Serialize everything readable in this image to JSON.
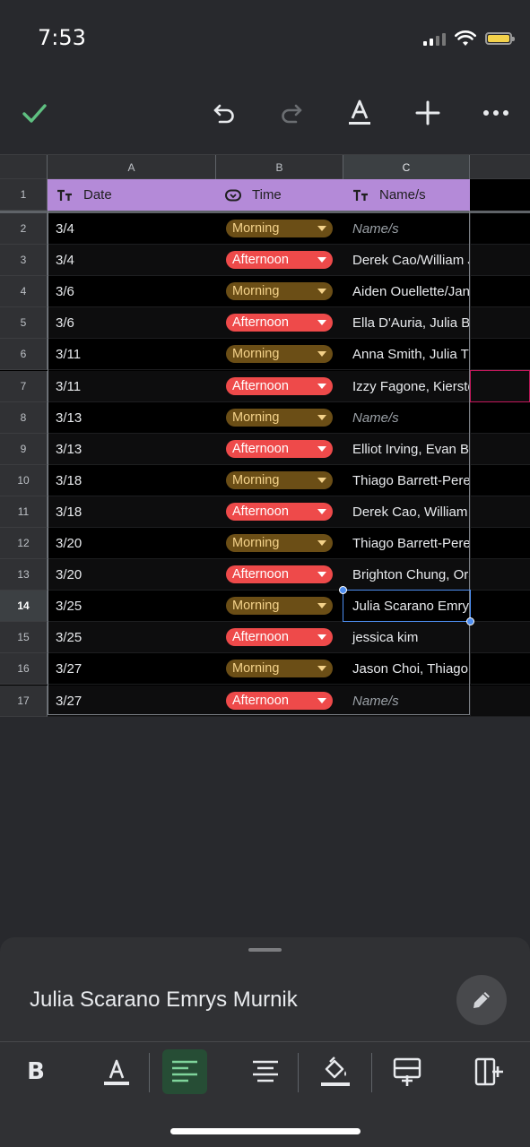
{
  "status_bar": {
    "time": "7:53"
  },
  "toolbar": {
    "done_icon": "check-icon",
    "undo_icon": "undo-icon",
    "redo_icon": "redo-icon",
    "text_format_icon": "text-color-icon",
    "insert_icon": "plus-icon",
    "more_icon": "more-horizontal-icon"
  },
  "columns": [
    "A",
    "B",
    "C"
  ],
  "header": {
    "row_number": "1",
    "date": "Date",
    "time": "Time",
    "names": "Name/s"
  },
  "rows": [
    {
      "num": "2",
      "date": "3/4",
      "time": "Morning",
      "name": "Name/s",
      "placeholder": true
    },
    {
      "num": "3",
      "date": "3/4",
      "time": "Afternoon",
      "name": "Derek Cao/William J",
      "placeholder": false
    },
    {
      "num": "4",
      "date": "3/6",
      "time": "Morning",
      "name": "Aiden Ouellette/Jan",
      "placeholder": false
    },
    {
      "num": "5",
      "date": "3/6",
      "time": "Afternoon",
      "name": "Ella D'Auria, Julia Bu",
      "placeholder": false
    },
    {
      "num": "6",
      "date": "3/11",
      "time": "Morning",
      "name": "Anna Smith, Julia Tu",
      "placeholder": false
    },
    {
      "num": "7",
      "date": "3/11",
      "time": "Afternoon",
      "name": "Izzy Fagone, Kierste",
      "placeholder": false
    },
    {
      "num": "8",
      "date": "3/13",
      "time": "Morning",
      "name": "Name/s",
      "placeholder": true
    },
    {
      "num": "9",
      "date": "3/13",
      "time": "Afternoon",
      "name": "Elliot Irving, Evan Ba",
      "placeholder": false
    },
    {
      "num": "10",
      "date": "3/18",
      "time": "Morning",
      "name": "Thiago Barrett-Pere",
      "placeholder": false
    },
    {
      "num": "11",
      "date": "3/18",
      "time": "Afternoon",
      "name": "Derek Cao, William J",
      "placeholder": false
    },
    {
      "num": "12",
      "date": "3/20",
      "time": "Morning",
      "name": "Thiago Barrett-Pere",
      "placeholder": false
    },
    {
      "num": "13",
      "date": "3/20",
      "time": "Afternoon",
      "name": "Brighton Chung, Ora",
      "placeholder": false
    },
    {
      "num": "14",
      "date": "3/25",
      "time": "Morning",
      "name": "Julia Scarano Emrys",
      "placeholder": false
    },
    {
      "num": "15",
      "date": "3/25",
      "time": "Afternoon",
      "name": "jessica kim",
      "placeholder": false
    },
    {
      "num": "16",
      "date": "3/27",
      "time": "Morning",
      "name": "Jason Choi, Thiago",
      "placeholder": false
    },
    {
      "num": "17",
      "date": "3/27",
      "time": "Afternoon",
      "name": "Name/s",
      "placeholder": true
    }
  ],
  "selected_row": "14",
  "colors": {
    "header_bg": "#b48ad8",
    "morning_chip": "#6b4e16",
    "afternoon_chip": "#ee4a4a",
    "selection": "#4d8df0",
    "done_check": "#5fc081"
  },
  "bottom_panel": {
    "cell_value": "Julia Scarano Emrys Murnik",
    "edit_icon": "pencil-icon",
    "format_icons": [
      "bold-icon",
      "text-color-icon",
      "align-left-icon",
      "align-center-icon",
      "fill-color-icon",
      "insert-row-icon",
      "insert-column-icon"
    ],
    "bold_label": "B"
  }
}
